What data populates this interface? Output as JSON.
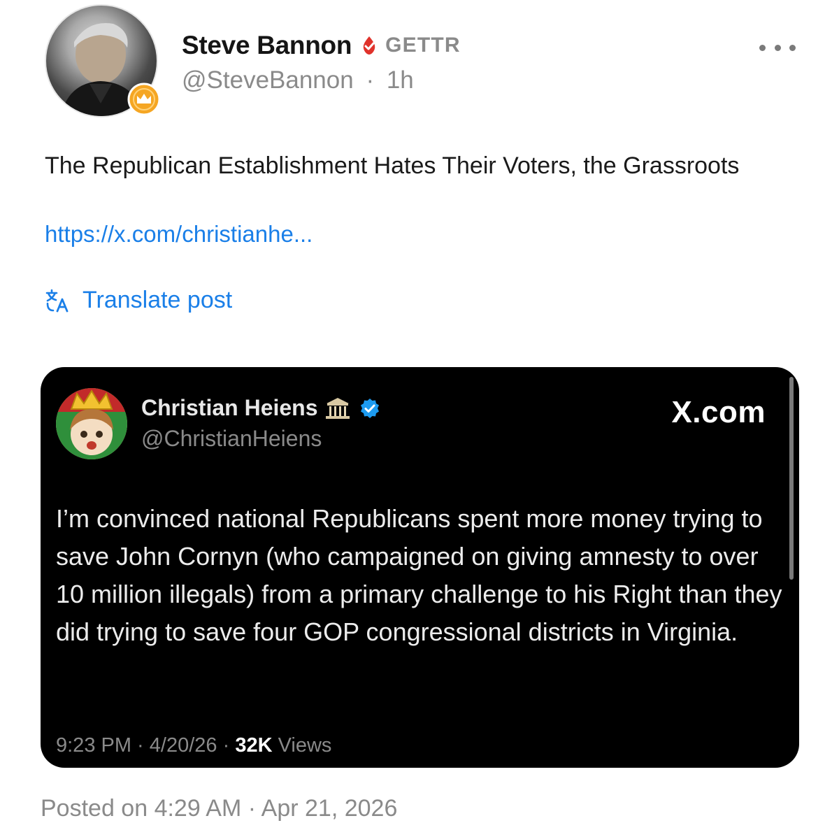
{
  "author": {
    "name": "Steve Bannon",
    "app_label": "GETTR",
    "handle": "@SteveBannon",
    "separator": "·",
    "time_ago": "1h",
    "avatar": "profile-photo",
    "badge_icon": "crown-icon"
  },
  "post": {
    "text": "The Republican Establishment Hates Their Voters, the Grassroots",
    "link": "https://x.com/christianhe...",
    "translate_label": "Translate post",
    "translate_icon": "translate-icon"
  },
  "embed": {
    "name": "Christian Heiens",
    "name_emoji": "classical-building-icon",
    "handle": "@ChristianHeiens",
    "source_label": "X.com",
    "body": "I’m convinced national Republicans spent more money trying to save John Cornyn (who campaigned on giving amnesty to over 10 million illegals) from a primary challenge to his Right than they did trying to save four GOP congressional districts in Virginia.",
    "time": "9:23 PM",
    "date": "4/20/26",
    "views_count": "32K",
    "views_label": "Views",
    "separator": "·"
  },
  "footer": {
    "posted_on": "Posted on 4:29 AM · Apr 21, 2026"
  },
  "colors": {
    "link": "#1a7fe8",
    "gettr_red": "#e0322b",
    "badge_orange": "#f5a623",
    "x_verified": "#1d9bf0"
  }
}
